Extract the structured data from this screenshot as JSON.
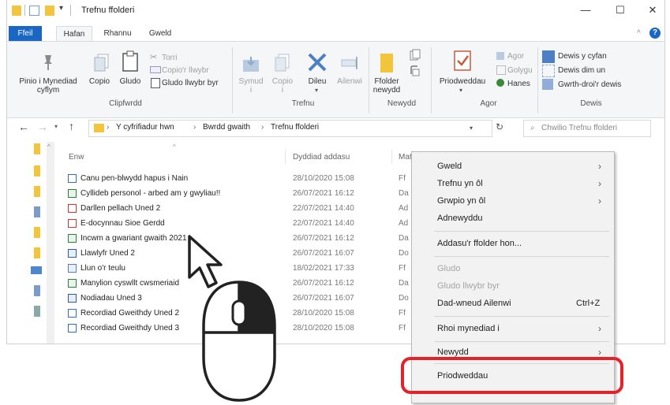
{
  "window": {
    "title": "Trefnu ffolderi",
    "minimize": "—",
    "maximize": "☐",
    "close": "✕"
  },
  "tabs": [
    "Ffeil",
    "Hafan",
    "Rhannu",
    "Gweld"
  ],
  "ribbon": {
    "pin": [
      "Pinio i Mynediad",
      "cyflym"
    ],
    "copy": "Copio",
    "paste": "Gludo",
    "cut": "Torri",
    "copy_path": "Copio'r llwybr",
    "paste_shortcut": "Gludo llwybr byr",
    "move": [
      "Symud",
      "i"
    ],
    "copy_to": [
      "Copio",
      "i"
    ],
    "delete": "Dileu",
    "rename": "Ailenwi",
    "new_folder": [
      "Ffolder",
      "newydd"
    ],
    "properties": "Priodweddau",
    "open": "Agor",
    "edit": "Golygu",
    "history": "Hanes",
    "select_all": "Dewis y cyfan",
    "select_none": "Dewis dim un",
    "invert": "Gwrth-droi'r dewis",
    "groups": [
      "Clipfwrdd",
      "Trefnu",
      "Newydd",
      "Agor",
      "Dewis"
    ]
  },
  "address": {
    "crumbs": [
      "Y cyfrifiadur hwn",
      "Bwrdd gwaith",
      "Trefnu ffolderi"
    ],
    "search_placeholder": "Chwilio Trefnu ffolderi"
  },
  "columns": {
    "name": "Enw",
    "date": "Dyddiad addasu",
    "type": "Math"
  },
  "files": [
    {
      "name": "Canu pen-blwydd hapus i Nain",
      "date": "28/10/2020 15:08",
      "type": "Ff",
      "icon": "doc-blue"
    },
    {
      "name": "Cyllideb personol - arbed am y gwyliau!!",
      "date": "26/07/2021 16:12",
      "type": "Da",
      "icon": "sheet-green"
    },
    {
      "name": "Darllen pellach Uned 2",
      "date": "22/07/2021 14:40",
      "type": "Ad",
      "icon": "pdf-red"
    },
    {
      "name": "E-docynnau Sioe Gerdd",
      "date": "22/07/2021 14:40",
      "type": "Ad",
      "icon": "pdf-red"
    },
    {
      "name": "Incwm a gwariant gwaith 2021",
      "date": "26/07/2021 16:12",
      "type": "Da",
      "icon": "sheet-green"
    },
    {
      "name": "Llawlyfr Uned 2",
      "date": "26/07/2021 16:07",
      "type": "Do",
      "icon": "word-blue"
    },
    {
      "name": "Llun o'r teulu",
      "date": "18/02/2021 17:33",
      "type": "Ff",
      "icon": "image"
    },
    {
      "name": "Manylion cyswllt cwsmeriaid",
      "date": "26/07/2021 16:12",
      "type": "Da",
      "icon": "sheet-green"
    },
    {
      "name": "Nodiadau Uned 3",
      "date": "26/07/2021 16:07",
      "type": "Do",
      "icon": "word-blue"
    },
    {
      "name": "Recordiad Gweithdy Uned 2",
      "date": "28/10/2020 15:08",
      "type": "Ff",
      "icon": "doc-blue"
    },
    {
      "name": "Recordiad Gweithdy Uned 3",
      "date": "28/10/2020 15:08",
      "type": "Ff",
      "icon": "doc-blue"
    }
  ],
  "context_menu": {
    "view": "Gweld",
    "sort_by": "Trefnu yn ôl",
    "group_by": "Grwpio yn ôl",
    "refresh": "Adnewyddu",
    "customize": "Addasu'r ffolder hon...",
    "paste": "Gludo",
    "paste_shortcut": "Gludo llwybr byr",
    "undo_rename": "Dad-wneud Ailenwi",
    "undo_shortcut": "Ctrl+Z",
    "give_access": "Rhoi mynediad i",
    "new": "Newydd",
    "properties": "Priodweddau"
  },
  "colors": {
    "accent": "#1a66c4",
    "highlight": "#e52228",
    "folder": "#f2c53d"
  }
}
